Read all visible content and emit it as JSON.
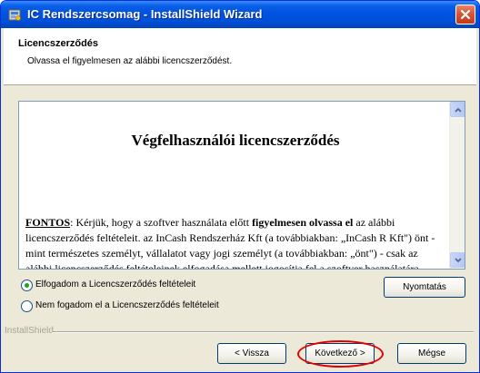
{
  "window": {
    "title": "IC Rendszercsomag - InstallShield Wizard"
  },
  "header": {
    "title": "Licencszerződés",
    "subtitle": "Olvassa el figyelmesen az alábbi licencszerződést."
  },
  "license": {
    "heading": "Végfelhasználói licencszerződés",
    "important_label": "FONTOS",
    "text_before_bold": ": Kérjük, hogy a szoftver használata előtt ",
    "bold_text": "figyelmesen olvassa el",
    "text_after_bold": " az alábbi licencszerződés feltételeit. az InCash Rendszerház Kft (a továbbiakban: „InCash R Kft\") önt - mint természetes személyt, vállalatot vagy jogi személyt (a továbbiakban: „önt\") - csak az alábbi licencszerződés feltételeinek elfogadása mellett jogosítja fel a szoftver használatára"
  },
  "options": {
    "accept_label": "Elfogadom a Licencszerződés feltételeit",
    "decline_label": "Nem fogadom el a Licencszerződés feltételeit",
    "selected": "accept"
  },
  "buttons": {
    "print": "Nyomtatás",
    "back": "< Vissza",
    "next": "Következő >",
    "cancel": "Mégse"
  },
  "footer": {
    "brand": "InstallShield"
  },
  "colors": {
    "titlebar": "#0053e1",
    "highlight": "#e00000",
    "radio_selected": "#21a121"
  }
}
